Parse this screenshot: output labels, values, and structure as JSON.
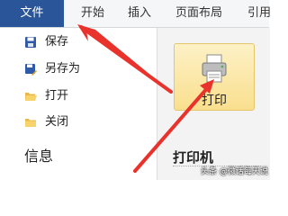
{
  "ribbon": {
    "tabs": [
      {
        "label": "文件",
        "active": true
      },
      {
        "label": "开始"
      },
      {
        "label": "插入"
      },
      {
        "label": "页面布局"
      },
      {
        "label": "引用"
      }
    ]
  },
  "backstage": {
    "menu": [
      {
        "label": "保存",
        "icon": "save-icon"
      },
      {
        "label": "另存为",
        "icon": "save-as-icon"
      },
      {
        "label": "打开",
        "icon": "open-folder-icon"
      },
      {
        "label": "关闭",
        "icon": "close-folder-icon"
      }
    ],
    "section_info": "信息",
    "print_button_label": "打印",
    "printer_heading": "打印机"
  },
  "watermark": "头条 @微话每天说",
  "colors": {
    "active_tab": "#2a5699",
    "annotation_arrow": "#e8322b",
    "print_button": "#f9df8e"
  }
}
